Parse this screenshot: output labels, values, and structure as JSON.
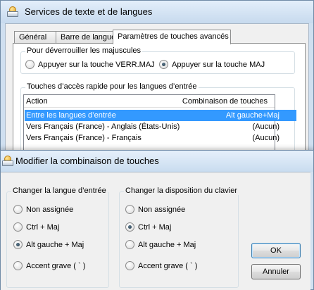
{
  "back_window": {
    "title": "Services de texte et de langues",
    "tabs": [
      {
        "label": "Général"
      },
      {
        "label": "Barre de langue"
      },
      {
        "label": "Paramètres de touches avancés",
        "active": true
      }
    ],
    "caps_group": {
      "title": "Pour déverrouiller les majuscules",
      "options": [
        {
          "label": "Appuyer sur la touche VERR.MAJ",
          "selected": false
        },
        {
          "label": "Appuyer sur la touche MAJ",
          "selected": true
        }
      ]
    },
    "hotkeys_group": {
      "title": "Touches d’accès rapide pour les langues d’entrée",
      "columns": {
        "action": "Action",
        "combo": "Combinaison de touches"
      },
      "rows": [
        {
          "action": "Entre les langues d’entrée",
          "combo": "Alt gauche+Maj",
          "selected": true
        },
        {
          "action": "Vers Français (France) - Anglais (États-Unis)",
          "combo": "(Aucun)",
          "selected": false
        },
        {
          "action": "Vers Français (France) - Français",
          "combo": "(Aucun)",
          "selected": false
        }
      ]
    }
  },
  "dialog": {
    "title": "Modifier la combinaison de touches",
    "input_language_group": {
      "title": "Changer la langue d’entrée",
      "options": [
        {
          "label": "Non assignée",
          "selected": false
        },
        {
          "label": "Ctrl + Maj",
          "selected": false
        },
        {
          "label": "Alt gauche + Maj",
          "selected": true
        },
        {
          "label": "Accent grave ( ` )",
          "selected": false
        }
      ]
    },
    "keyboard_layout_group": {
      "title": "Changer la disposition du clavier",
      "options": [
        {
          "label": "Non assignée",
          "selected": false
        },
        {
          "label": "Ctrl + Maj",
          "selected": true
        },
        {
          "label": "Alt gauche + Maj",
          "selected": false
        },
        {
          "label": "Accent grave ( ` )",
          "selected": false
        }
      ]
    },
    "ok_label": "OK",
    "cancel_label": "Annuler"
  },
  "icons": {
    "app": "keyboard-globe-icon",
    "radio_on": "radio-selected-icon",
    "radio_off": "radio-unselected-icon"
  },
  "colors": {
    "selection": "#3399ff",
    "titlebar": "#c9dcef",
    "dialog_face": "#f0f0f0"
  }
}
